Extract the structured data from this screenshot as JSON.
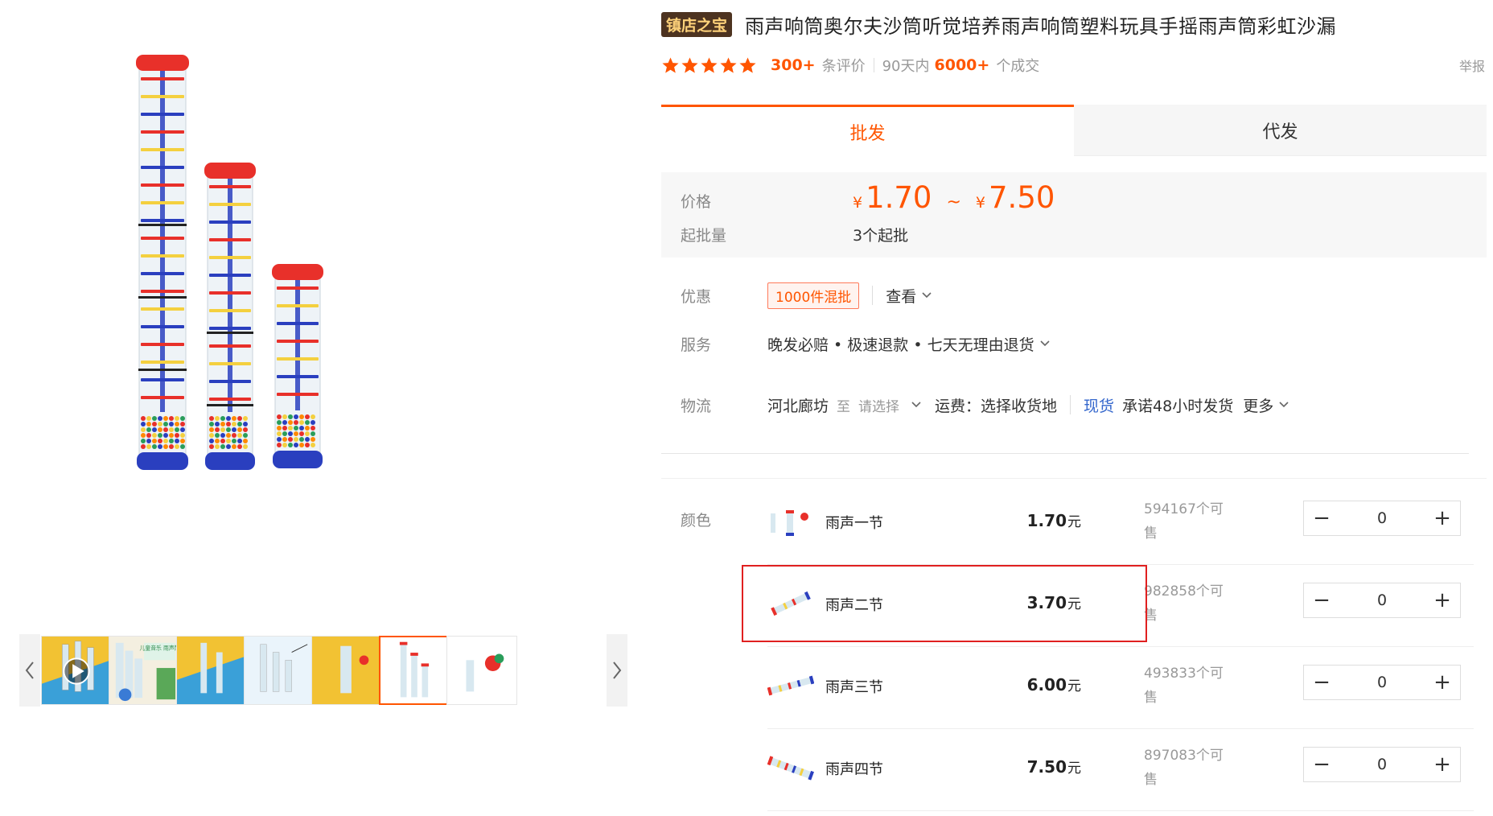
{
  "gallery": {
    "thumbnails": [
      {
        "name": "thumbnail-1"
      },
      {
        "name": "thumbnail-2",
        "overlay_text": "儿童音乐 雨声筒"
      },
      {
        "name": "thumbnail-3"
      },
      {
        "name": "thumbnail-4"
      },
      {
        "name": "thumbnail-5"
      },
      {
        "name": "thumbnail-6",
        "active": true
      },
      {
        "name": "thumbnail-7"
      }
    ],
    "prev_icon": "chevron-left-icon",
    "next_icon": "chevron-right-icon"
  },
  "product": {
    "store_badge": "镇店之宝",
    "title": "雨声响筒奥尔夫沙筒听觉培养雨声响筒塑料玩具手摇雨声筒彩虹沙漏",
    "rating_stars": 5,
    "review_count": "300+",
    "review_label": "条评价",
    "period_label": "90天内",
    "deal_count": "6000+",
    "deal_label": "个成交",
    "report_label": "举报"
  },
  "tabs": {
    "wholesale": "批发",
    "dropship": "代发"
  },
  "pricing": {
    "price_label": "价格",
    "currency": "¥",
    "price_low": "1.70",
    "price_sep": "~",
    "price_high": "7.50",
    "moq_label": "起批量",
    "moq_value": "3个起批"
  },
  "promo": {
    "label": "优惠",
    "tag": "1000件混批",
    "view_label": "查看"
  },
  "service": {
    "label": "服务",
    "text": "晚发必赔 • 极速退款 • 七天无理由退货"
  },
  "logistics": {
    "label": "物流",
    "origin": "河北廊坊",
    "to": "至",
    "destination_placeholder": "请选择",
    "shipping_fee": "运费：选择收货地",
    "stock_status": "现货",
    "promise": "承诺48小时发货",
    "more": "更多"
  },
  "sku": {
    "label": "颜色",
    "items": [
      {
        "name": "雨声一节",
        "price": "1.70",
        "unit": "元",
        "stock_line1": "594167个可",
        "stock_line2": "售",
        "qty": "0"
      },
      {
        "name": "雨声二节",
        "price": "3.70",
        "unit": "元",
        "stock_line1": "982858个可",
        "stock_line2": "售",
        "qty": "0",
        "highlighted": true
      },
      {
        "name": "雨声三节",
        "price": "6.00",
        "unit": "元",
        "stock_line1": "493833个可",
        "stock_line2": "售",
        "qty": "0"
      },
      {
        "name": "雨声四节",
        "price": "7.50",
        "unit": "元",
        "stock_line1": "897083个可",
        "stock_line2": "售",
        "qty": "0"
      }
    ],
    "minus": "−",
    "plus": "+"
  },
  "colors": {
    "accent": "#ff5500",
    "badge_bg": "#4d3320",
    "badge_text": "#ffd27a",
    "highlight_border": "#e02020",
    "link_blue": "#3366cc",
    "tube_red": "#e8302a",
    "tube_blue": "#2a3fbf",
    "tube_yellow": "#f4d03f"
  }
}
